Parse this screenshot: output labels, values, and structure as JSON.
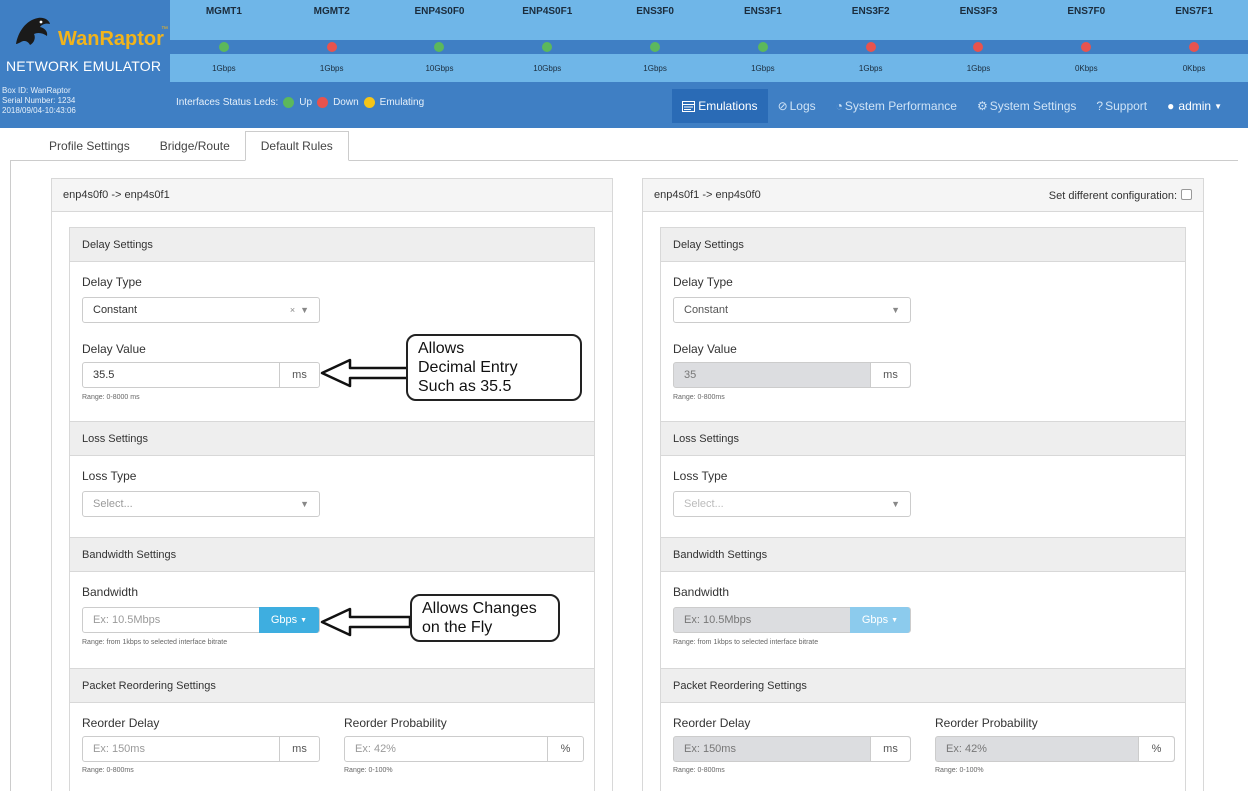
{
  "brand": {
    "name": "WanRaptor",
    "tm": "™",
    "subtitle": "NETWORK EMULATOR"
  },
  "interfaces": [
    {
      "name": "MGMT1",
      "status": "up",
      "speed": "1Gbps"
    },
    {
      "name": "MGMT2",
      "status": "down",
      "speed": "1Gbps"
    },
    {
      "name": "ENP4S0F0",
      "status": "up",
      "speed": "10Gbps"
    },
    {
      "name": "ENP4S0F1",
      "status": "up",
      "speed": "10Gbps"
    },
    {
      "name": "ENS3F0",
      "status": "up",
      "speed": "1Gbps"
    },
    {
      "name": "ENS3F1",
      "status": "up",
      "speed": "1Gbps"
    },
    {
      "name": "ENS3F2",
      "status": "down",
      "speed": "1Gbps"
    },
    {
      "name": "ENS3F3",
      "status": "down",
      "speed": "1Gbps"
    },
    {
      "name": "ENS7F0",
      "status": "down",
      "speed": "0Kbps"
    },
    {
      "name": "ENS7F1",
      "status": "down",
      "speed": "0Kbps"
    }
  ],
  "colors": {
    "up": "#5cb85c",
    "down": "#e8534e",
    "emulating": "#f5c518"
  },
  "box_info": {
    "box_id": "Box ID: WanRaptor",
    "serial": "Serial Number: 1234",
    "datetime": "2018/09/04-10:43:06"
  },
  "legend": {
    "label": "Interfaces Status Leds:",
    "up": "Up",
    "down": "Down",
    "emulating": "Emulating"
  },
  "nav": {
    "emulations": "Emulations",
    "logs": "Logs",
    "performance": "System Performance",
    "settings": "System Settings",
    "support": "Support",
    "user": "admin"
  },
  "tabs": [
    "Profile Settings",
    "Bridge/Route",
    "Default Rules"
  ],
  "left": {
    "title": "enp4s0f0 -> enp4s0f1",
    "delay_header": "Delay Settings",
    "delay_type_label": "Delay Type",
    "delay_type_value": "Constant",
    "delay_value_label": "Delay Value",
    "delay_value": "35.5",
    "delay_unit": "ms",
    "delay_range": "Range: 0-8000 ms",
    "loss_header": "Loss Settings",
    "loss_type_label": "Loss Type",
    "loss_type_placeholder": "Select...",
    "bw_header": "Bandwidth Settings",
    "bw_label": "Bandwidth",
    "bw_placeholder": "Ex: 10.5Mbps",
    "bw_unit": "Gbps",
    "bw_range": "Range: from 1kbps to selected interface bitrate",
    "reorder_header": "Packet Reordering Settings",
    "reorder_delay_label": "Reorder Delay",
    "reorder_delay_placeholder": "Ex: 150ms",
    "reorder_delay_unit": "ms",
    "reorder_delay_range": "Range: 0-800ms",
    "reorder_prob_label": "Reorder Probability",
    "reorder_prob_placeholder": "Ex: 42%",
    "reorder_prob_unit": "%",
    "reorder_prob_range": "Range: 0-100%"
  },
  "right": {
    "title": "enp4s0f1 -> enp4s0f0",
    "diff_config_label": "Set different configuration:",
    "delay_header": "Delay Settings",
    "delay_type_label": "Delay Type",
    "delay_type_value": "Constant",
    "delay_value_label": "Delay Value",
    "delay_value": "35",
    "delay_unit": "ms",
    "delay_range": "Range: 0-800ms",
    "loss_header": "Loss Settings",
    "loss_type_label": "Loss Type",
    "loss_type_placeholder": "Select...",
    "bw_header": "Bandwidth Settings",
    "bw_label": "Bandwidth",
    "bw_placeholder": "Ex: 10.5Mbps",
    "bw_unit": "Gbps",
    "bw_range": "Range: from 1kbps to selected interface bitrate",
    "reorder_header": "Packet Reordering Settings",
    "reorder_delay_label": "Reorder Delay",
    "reorder_delay_placeholder": "Ex: 150ms",
    "reorder_delay_unit": "ms",
    "reorder_delay_range": "Range: 0-800ms",
    "reorder_prob_label": "Reorder Probability",
    "reorder_prob_placeholder": "Ex: 42%",
    "reorder_prob_unit": "%",
    "reorder_prob_range": "Range: 0-100%"
  },
  "callouts": {
    "decimal": [
      "Allows",
      "Decimal Entry",
      "Such as 35.5"
    ],
    "fly": [
      "Allows Changes",
      "on the Fly"
    ]
  }
}
